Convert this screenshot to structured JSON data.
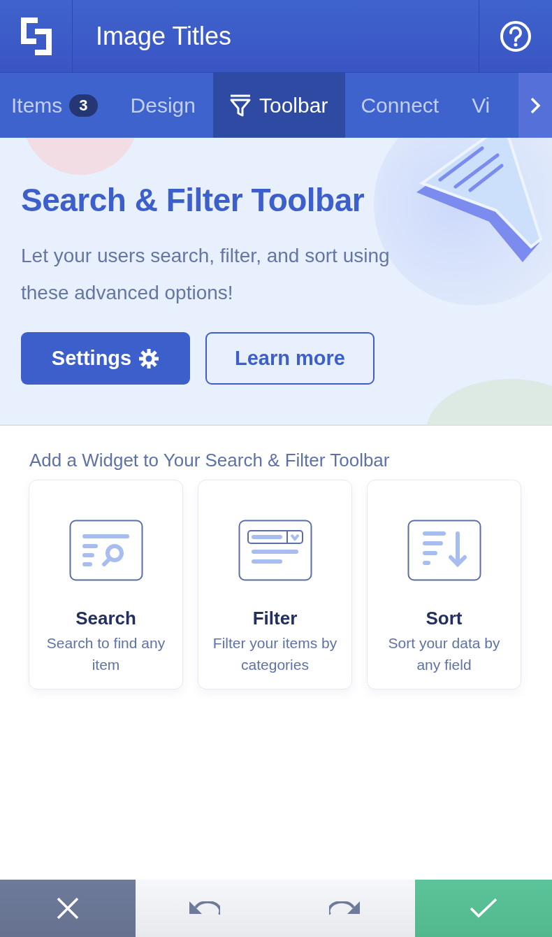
{
  "header": {
    "title": "Image Titles"
  },
  "tabs": [
    {
      "label": "Items",
      "badge": "3",
      "selected": false,
      "icon": false
    },
    {
      "label": "Design",
      "selected": false,
      "icon": false
    },
    {
      "label": "Toolbar",
      "selected": true,
      "icon": true
    },
    {
      "label": "Connect",
      "selected": false,
      "icon": false
    },
    {
      "label": "Vi",
      "selected": false,
      "icon": false
    }
  ],
  "hero": {
    "title": "Search & Filter Toolbar",
    "text": "Let your users search, filter, and sort using these advanced options!",
    "primary_button": "Settings",
    "secondary_button": "Learn more"
  },
  "widgets": {
    "heading": "Add a Widget to Your Search & Filter Toolbar",
    "items": [
      {
        "kind": "search",
        "title": "Search",
        "description": "Search to find any item"
      },
      {
        "kind": "filter",
        "title": "Filter",
        "description": "Filter your items by categories"
      },
      {
        "kind": "sort",
        "title": "Sort",
        "description": "Sort your data by any field"
      }
    ]
  }
}
